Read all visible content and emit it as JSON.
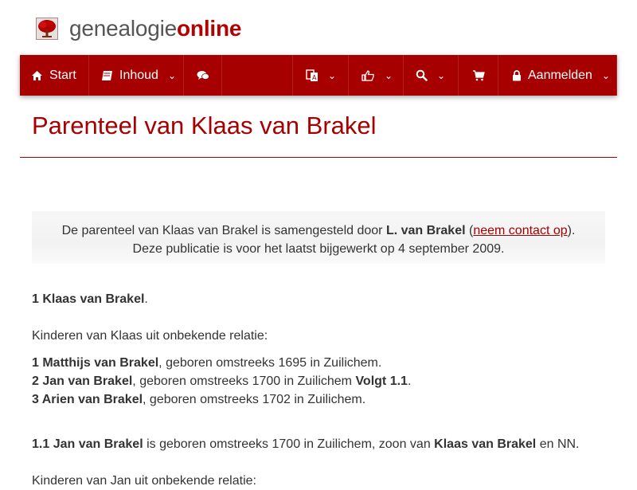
{
  "brand": {
    "part1": "genealogie",
    "part2": "online"
  },
  "nav": {
    "start": "Start",
    "inhoud": "Inhoud",
    "login": "Aanmelden",
    "icons": [
      "home-icon",
      "book-icon",
      "comments-icon",
      "language-icon",
      "share-icon",
      "search-icon",
      "cart-icon",
      "lock-icon"
    ]
  },
  "page": {
    "title": "Parenteel van Klaas van Brakel"
  },
  "info": {
    "line1_prefix": "De parenteel van Klaas van Brakel is samengesteld door ",
    "author": "L. van Brakel",
    "open_paren": " (",
    "contact_link": "neem contact op",
    "close_paren": ").",
    "line2": "Deze publicatie is voor het laatst bijgewerkt op 4 september 2009."
  },
  "content": {
    "person1": {
      "name": "1 Klaas van Brakel",
      "after": "."
    },
    "children_header": "Kinderen van Klaas uit onbekende relatie:",
    "children": [
      {
        "name": "1 Matthijs van Brakel",
        "text": ", geboren omstreeks 1695 in Zuilichem."
      },
      {
        "name": "2 Jan van Brakel",
        "text": ", geboren omstreeks 1700 in Zuilichem ",
        "follow": "Volgt 1.1",
        "end": "."
      },
      {
        "name": "3 Arien van Brakel",
        "text": ", geboren omstreeks 1702 in Zuilichem."
      }
    ],
    "person2": {
      "name": "1.1 Jan van Brakel",
      "text": " is geboren omstreeks 1700 in Zuilichem, zoon van ",
      "father": "Klaas van Brakel",
      "end": " en NN."
    },
    "children_header2": "Kinderen van Jan uit onbekende relatie:"
  },
  "colors": {
    "brand_red": "#a70000",
    "text": "#333333"
  }
}
